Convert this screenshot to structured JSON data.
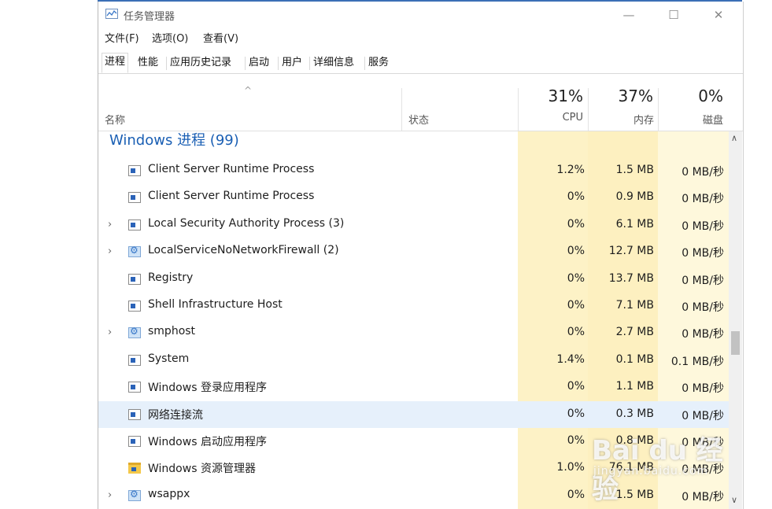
{
  "window": {
    "title": "任务管理器",
    "controls": [
      "—",
      "☐",
      "✕"
    ]
  },
  "menu": [
    "文件(F)",
    "选项(O)",
    "查看(V)"
  ],
  "tabs": [
    "进程",
    "性能",
    "应用历史记录",
    "启动",
    "用户",
    "详细信息",
    "服务"
  ],
  "active_tab": "进程",
  "columns": {
    "name": "名称",
    "status": "状态",
    "cpu": {
      "percent": "31%",
      "label": "CPU"
    },
    "memory": {
      "percent": "37%",
      "label": "内存"
    },
    "disk": {
      "percent": "0%",
      "label": "磁盘"
    }
  },
  "group": {
    "title": "Windows 进程 (99)"
  },
  "processes": [
    {
      "name": "Client Server Runtime Process",
      "cpu": "1.2%",
      "mem": "1.5 MB",
      "disk": "0 MB/秒",
      "icon": "window-icon",
      "expandable": false
    },
    {
      "name": "Client Server Runtime Process",
      "cpu": "0%",
      "mem": "0.9 MB",
      "disk": "0 MB/秒",
      "icon": "window-icon",
      "expandable": false
    },
    {
      "name": "Local Security Authority Process (3)",
      "cpu": "0%",
      "mem": "6.1 MB",
      "disk": "0 MB/秒",
      "icon": "window-icon",
      "expandable": true
    },
    {
      "name": "LocalServiceNoNetworkFirewall (2)",
      "cpu": "0%",
      "mem": "12.7 MB",
      "disk": "0 MB/秒",
      "icon": "gear-icon",
      "expandable": true
    },
    {
      "name": "Registry",
      "cpu": "0%",
      "mem": "13.7 MB",
      "disk": "0 MB/秒",
      "icon": "window-icon",
      "expandable": false
    },
    {
      "name": "Shell Infrastructure Host",
      "cpu": "0%",
      "mem": "7.1 MB",
      "disk": "0 MB/秒",
      "icon": "window-icon",
      "expandable": false
    },
    {
      "name": "smphost",
      "cpu": "0%",
      "mem": "2.7 MB",
      "disk": "0 MB/秒",
      "icon": "gear-icon",
      "expandable": true
    },
    {
      "name": "System",
      "cpu": "1.4%",
      "mem": "0.1 MB",
      "disk": "0.1 MB/秒",
      "icon": "window-icon",
      "expandable": false
    },
    {
      "name": "Windows 登录应用程序",
      "cpu": "0%",
      "mem": "1.1 MB",
      "disk": "0 MB/秒",
      "icon": "window-icon",
      "expandable": false
    },
    {
      "name": "网络连接流",
      "cpu": "0%",
      "mem": "0.3 MB",
      "disk": "0 MB/秒",
      "icon": "window-icon",
      "expandable": false,
      "selected": true
    },
    {
      "name": "Windows 启动应用程序",
      "cpu": "0%",
      "mem": "0.8 MB",
      "disk": "0 MB/秒",
      "icon": "window-icon",
      "expandable": false
    },
    {
      "name": "Windows 资源管理器",
      "cpu": "1.0%",
      "mem": "76.1 MB",
      "disk": "0 MB/秒",
      "icon": "folder-icon",
      "expandable": false
    },
    {
      "name": "wsappx",
      "cpu": "0%",
      "mem": "1.5 MB",
      "disk": "0 MB/秒",
      "icon": "gear-icon",
      "expandable": true
    }
  ],
  "colors": {
    "accent": "#1a5fb4",
    "cpu_bg": "#fdf2c6",
    "mem_bg": "#fdf0c0",
    "disk_bg": "#fef8dc",
    "selected": "#e6f0fb"
  },
  "watermark": {
    "line1": "Bai du 经验",
    "line2": "jingyan.baidu.com"
  }
}
